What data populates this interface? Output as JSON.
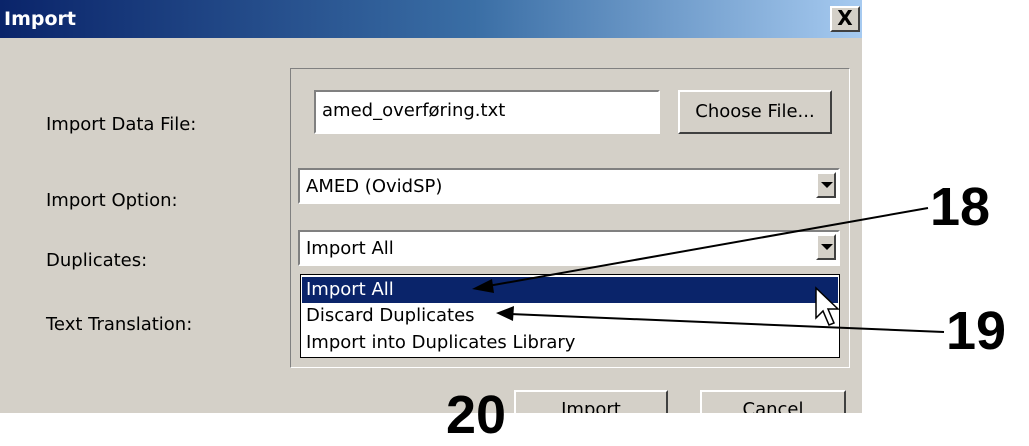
{
  "dialog": {
    "title": "Import",
    "close_label": "X"
  },
  "form": {
    "import_data_file_label": "Import Data File:",
    "import_option_label": "Import Option:",
    "duplicates_label": "Duplicates:",
    "text_translation_label": "Text Translation:",
    "file_value": "amed_overføring.txt",
    "choose_file_label": "Choose File...",
    "import_option_value": "AMED (OvidSP)",
    "duplicates_value": "Import All"
  },
  "duplicates_options": [
    {
      "label": "Import All",
      "selected": true
    },
    {
      "label": "Discard Duplicates",
      "selected": false
    },
    {
      "label": "Import into Duplicates Library",
      "selected": false
    }
  ],
  "buttons": {
    "import_label": "Import",
    "cancel_label": "Cancel"
  },
  "callouts": {
    "c18": "18",
    "c19": "19",
    "c20": "20"
  },
  "icons": [
    "close-icon",
    "dropdown-arrow-icon",
    "mouse-cursor-icon"
  ]
}
